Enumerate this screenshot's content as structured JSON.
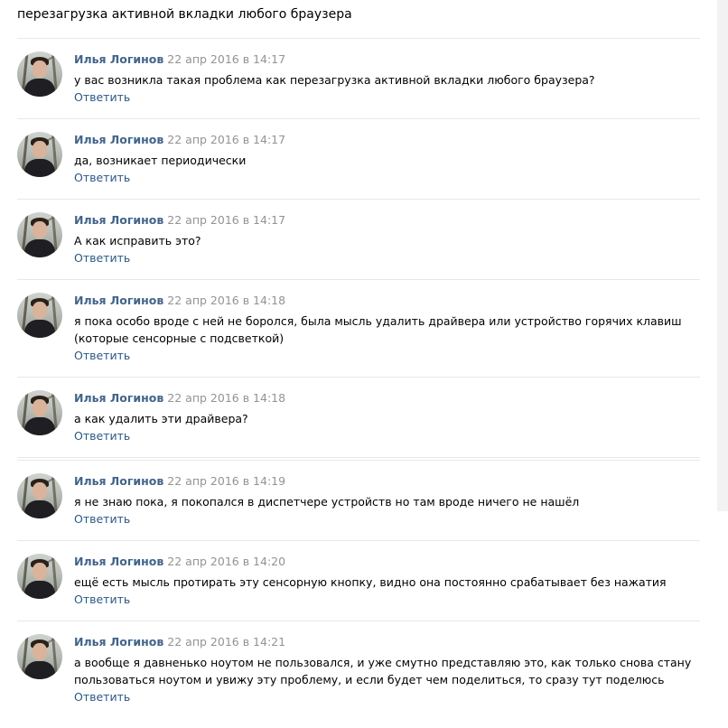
{
  "topic": {
    "title": "перезагрузка активной вкладки любого браузера"
  },
  "colors": {
    "author": "#42648b",
    "date": "#939393",
    "reply": "#2a5885",
    "divider": "#e7e8ec"
  },
  "icons": {
    "avatar": "user-photo-avatar"
  },
  "comments": [
    {
      "author": "Илья Логинов",
      "date": "22 апр 2016 в 14:17",
      "text": "у вас возникла такая проблема как перезагрузка активной вкладки любого браузера?",
      "reply_label": "Ответить"
    },
    {
      "author": "Илья Логинов",
      "date": "22 апр 2016 в 14:17",
      "text": "да, возникает периодически",
      "reply_label": "Ответить"
    },
    {
      "author": "Илья Логинов",
      "date": "22 апр 2016 в 14:17",
      "text": "А как исправить это?",
      "reply_label": "Ответить"
    },
    {
      "author": "Илья Логинов",
      "date": "22 апр 2016 в 14:18",
      "text": "я пока особо вроде с ней не боролся, была мысль удалить драйвера или устройство горячих клавиш (которые сенсорные с подсветкой)",
      "reply_label": "Ответить"
    },
    {
      "author": "Илья Логинов",
      "date": "22 апр 2016 в 14:18",
      "text": "а как удалить эти драйвера?",
      "reply_label": "Ответить"
    },
    {
      "author": "Илья Логинов",
      "date": "22 апр 2016 в 14:19",
      "text": "я не знаю пока, я покопался в диспетчере устройств но там вроде ничего не нашёл",
      "reply_label": "Ответить"
    },
    {
      "author": "Илья Логинов",
      "date": "22 апр 2016 в 14:20",
      "text": "ещё есть мысль протирать эту сенсорную кнопку, видно она постоянно срабатывает без нажатия",
      "reply_label": "Ответить"
    },
    {
      "author": "Илья Логинов",
      "date": "22 апр 2016 в 14:21",
      "text": "а вообще я давненько ноутом не пользовался, и уже смутно представляю это, как только снова стану пользоваться ноутом и увижу эту проблему, и если будет чем поделиться, то сразу тут поделюсь",
      "reply_label": "Ответить"
    }
  ]
}
